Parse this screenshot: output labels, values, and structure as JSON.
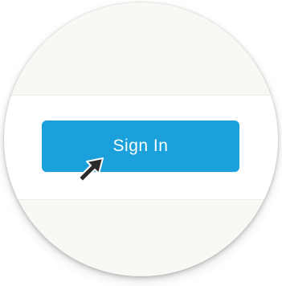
{
  "button": {
    "label": "Sign In",
    "color": "#1ba0dc",
    "text_color": "#ffffff"
  },
  "background": {
    "lens_color": "#f9f8f4",
    "strip_color": "#ffffff"
  },
  "cursor": {
    "icon": "arrow-cursor-icon"
  }
}
